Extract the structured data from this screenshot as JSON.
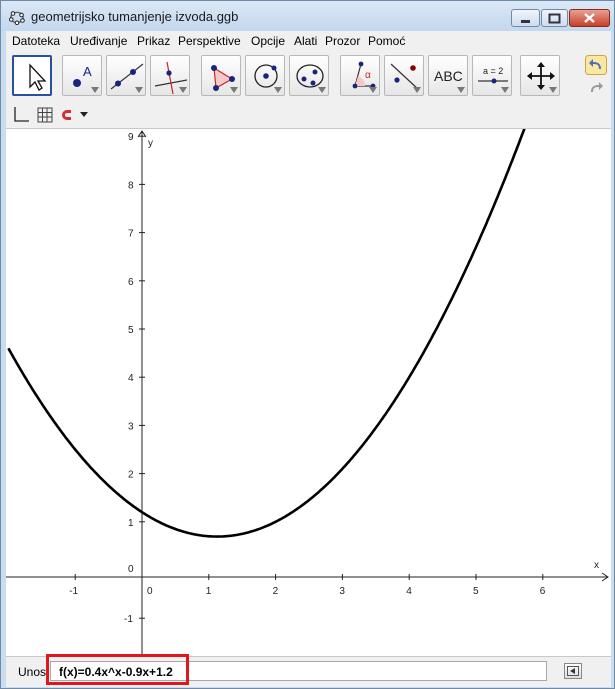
{
  "window": {
    "title": "geometrijsko tumanjenje izvoda.ggb"
  },
  "menu": [
    "Datoteka",
    "Uređivanje",
    "Prikaz",
    "Perspektive",
    "Opcije",
    "Alati",
    "Prozor",
    "Pomoć"
  ],
  "toolbar": {
    "text_tool_label": "ABC",
    "slider_tool_label": "a = 2"
  },
  "graphics": {
    "x_axis_label": "x",
    "y_axis_label": "y",
    "x_ticks": [
      "-1",
      "0",
      "1",
      "2",
      "3",
      "4",
      "5",
      "6"
    ],
    "y_ticks": [
      "9",
      "8",
      "7",
      "6",
      "5",
      "4",
      "3",
      "2",
      "1",
      "0",
      "-1"
    ],
    "curve_color": "#000000"
  },
  "chart_data": {
    "type": "line",
    "function": "f(x)=0.4x^x-0.9x+1.2",
    "x_range": [
      -2.0,
      7.0
    ],
    "y_range": [
      -1.7,
      9.3
    ],
    "x_tick_values": [
      -1,
      1,
      2,
      3,
      4,
      5,
      6
    ],
    "y_tick_values": [
      -1,
      1,
      2,
      3,
      4,
      5,
      6,
      7,
      8,
      9
    ],
    "series": [
      {
        "coefficients": {
          "a": 0.4,
          "b": -0.9,
          "c": 1.2
        }
      }
    ],
    "grid": false
  },
  "input_bar": {
    "label": "Unos:",
    "value": "f(x)=0.4x^x-0.9x+1.2"
  },
  "colors": {
    "highlight": "#e0171c",
    "selection": "#2a4fa0",
    "point_blue": "#1a237e",
    "accent_red": "#c62828"
  }
}
